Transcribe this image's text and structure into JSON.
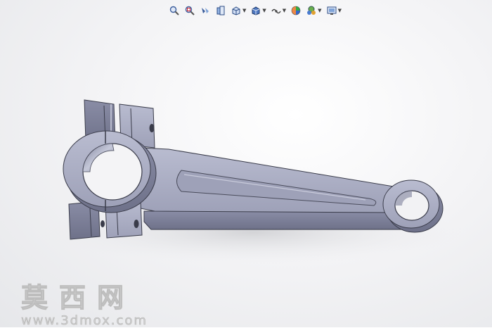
{
  "app": {
    "view": "3D model viewport"
  },
  "toolbar": {
    "buttons": [
      {
        "icon": "zoom-to-fit-icon"
      },
      {
        "icon": "zoom-to-area-icon"
      },
      {
        "icon": "previous-view-icon"
      },
      {
        "icon": "section-view-icon"
      },
      {
        "icon": "view-orientation-icon",
        "dropdown": true
      },
      {
        "icon": "display-style-icon",
        "dropdown": true
      },
      {
        "icon": "hide-show-items-icon",
        "dropdown": true
      },
      {
        "icon": "edit-appearance-icon"
      },
      {
        "icon": "apply-scene-icon",
        "dropdown": true
      },
      {
        "icon": "view-settings-icon",
        "dropdown": true
      }
    ]
  },
  "watermark": {
    "chinese": "莫西网",
    "url": "www.3dmox.com"
  },
  "colors": {
    "part_fill": "#a9acc2",
    "part_dark": "#7e8199",
    "part_edge": "#3a3c4a",
    "background": "#f4f4f6"
  }
}
